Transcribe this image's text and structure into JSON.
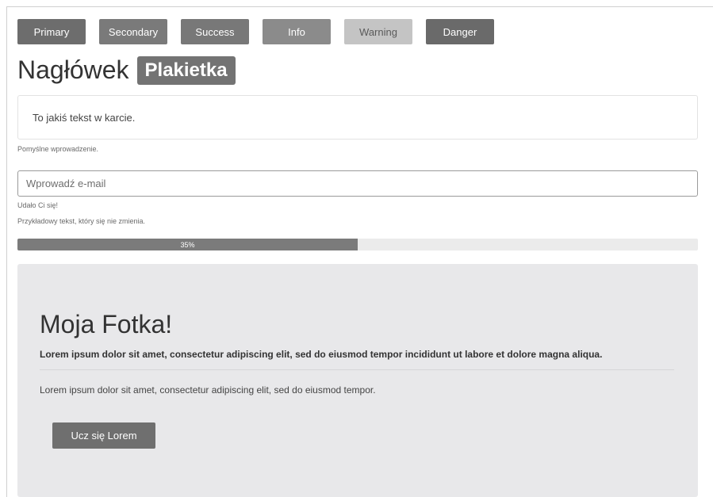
{
  "colors": {
    "primary": "#6d6d6d",
    "secondary": "#7a7a7a",
    "success": "#787878",
    "info": "#8b8b8b",
    "warning": "#c4c4c4",
    "danger": "#6a6a6a",
    "badge": "#737373",
    "progress": "#7b7b7b",
    "jumbotron_button": "#6f6f6f"
  },
  "buttons": {
    "primary": "Primary",
    "secondary": "Secondary",
    "success": "Success",
    "info": "Info",
    "warning": "Warning",
    "danger": "Danger"
  },
  "heading": {
    "text": "Nagłówek",
    "badge": "Plakietka"
  },
  "card": {
    "text": "To jakiś tekst w karcie."
  },
  "messages": {
    "success_entry": "Pomyślne wprowadzenie.",
    "success_done": "Udało Ci się!",
    "static_text": "Przykładowy tekst, który się nie zmienia."
  },
  "email": {
    "placeholder": "Wprowadź e-mail"
  },
  "progress": {
    "value": 0.5,
    "label": "35%"
  },
  "jumbotron": {
    "title": "Moja Fotka!",
    "lead": "Lorem ipsum dolor sit amet, consectetur adipiscing elit, sed do eiusmod tempor incididunt ut labore et dolore magna aliqua.",
    "text": "Lorem ipsum dolor sit amet, consectetur adipiscing elit, sed do eiusmod tempor.",
    "button": "Ucz się Lorem"
  }
}
